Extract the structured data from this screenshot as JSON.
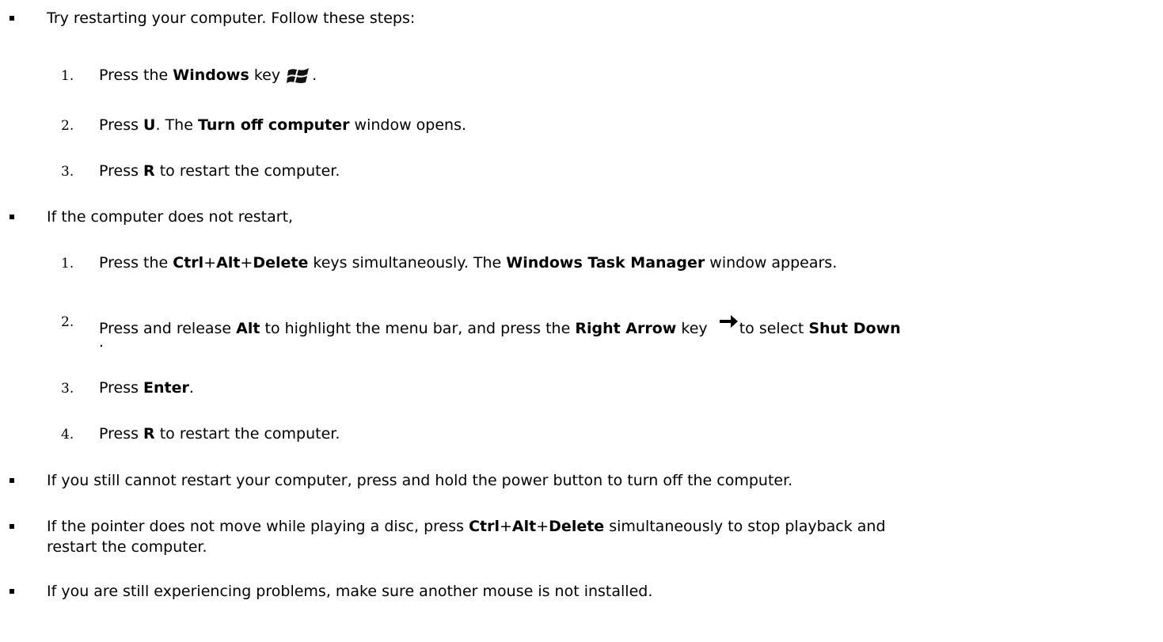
{
  "bullets": [
    {
      "text": "Try restarting your computer. Follow these steps:",
      "steps": [
        {
          "num": "1.",
          "pre": "Press the ",
          "b1": "Windows",
          "mid": " key",
          "icon": "windows-logo-icon",
          "post": "."
        },
        {
          "num": "2.",
          "pre": "Press ",
          "b1": "U",
          "mid": ". The ",
          "b2": "Turn off computer",
          "post": " window opens."
        },
        {
          "num": "3.",
          "pre": "Press ",
          "b1": "R",
          "post": " to restart the computer."
        }
      ]
    },
    {
      "text": "If the computer does not restart,",
      "steps": [
        {
          "num": "1.",
          "pre": "Press the ",
          "b1": "Ctrl",
          "p1": "+",
          "b2": "Alt",
          "p2": "+",
          "b3": "Delete",
          "mid": " keys simultaneously. The ",
          "b4": "Windows Task Manager",
          "post": " window appears."
        },
        {
          "num": "2.",
          "pre": "Press and release ",
          "b1": "Alt",
          "mid": " to highlight the menu bar, and press the ",
          "b2": "Right Arrow",
          "mid2": " key ",
          "icon": "right-arrow-icon",
          "mid3": "to select ",
          "b3": "Shut Down",
          "post": "."
        },
        {
          "num": "3.",
          "pre": "Press ",
          "b1": "Enter",
          "post": "."
        },
        {
          "num": "4.",
          "pre": "Press ",
          "b1": "R",
          "post": " to restart the computer."
        }
      ]
    },
    {
      "text": "If you still cannot restart your computer, press and hold the power button to turn off the computer."
    },
    {
      "pre": "If the pointer does not move while playing a disc, press ",
      "b1": "Ctrl",
      "p1": "+",
      "b2": "Alt",
      "p2": "+",
      "b3": "Delete",
      "post": " simultaneously to stop playback and",
      "line2": "restart the computer."
    },
    {
      "text": "If you are still experiencing problems, make sure another mouse is not installed."
    }
  ]
}
